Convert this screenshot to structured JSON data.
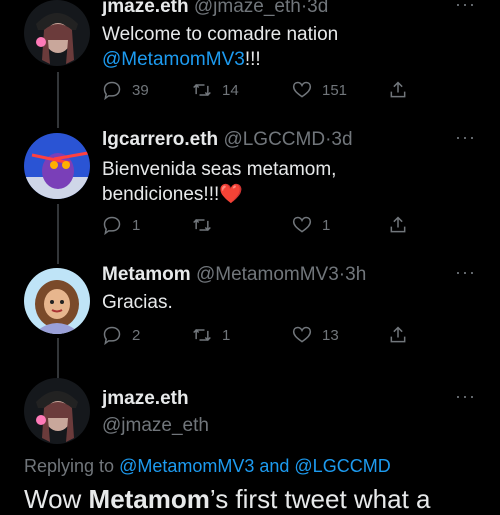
{
  "tweets": [
    {
      "display_name": "jmaze.eth",
      "handle": "@jmaze_eth",
      "time": "3d",
      "text_line1": "Welcome to comadre nation",
      "text_mention": "@MetamomMV3",
      "text_suffix": "!!!",
      "replies": "39",
      "retweets": "14",
      "likes": "151"
    },
    {
      "display_name": "lgcarrero.eth",
      "handle": "@LGCCMD",
      "time": "3d",
      "text_line1": "Bienvenida seas metamom,",
      "text_line2": "bendiciones!!!❤️",
      "replies": "1",
      "retweets": "",
      "likes": "1"
    },
    {
      "display_name": "Metamom",
      "handle": "@MetamomMV3",
      "time": "3h",
      "text_line1": "Gracias.",
      "replies": "2",
      "retweets": "1",
      "likes": "13"
    }
  ],
  "main_tweet": {
    "display_name": "jmaze.eth",
    "handle": "@jmaze_eth",
    "replying_prefix": "Replying to",
    "replying_to": "@MetamomMV3 and @LGCCMD",
    "text_start": "Wow ",
    "text_bold": "Metamom",
    "text_rest": "’s first tweet what a"
  },
  "separator": "·",
  "more_label": "···",
  "colors": {
    "background": "#000000",
    "text": "#e7e9ea",
    "muted": "#71767b",
    "accent": "#1d9bf0",
    "heart": "#f91880"
  },
  "icons": [
    "reply-icon",
    "retweet-icon",
    "like-icon",
    "share-icon",
    "more-icon"
  ]
}
